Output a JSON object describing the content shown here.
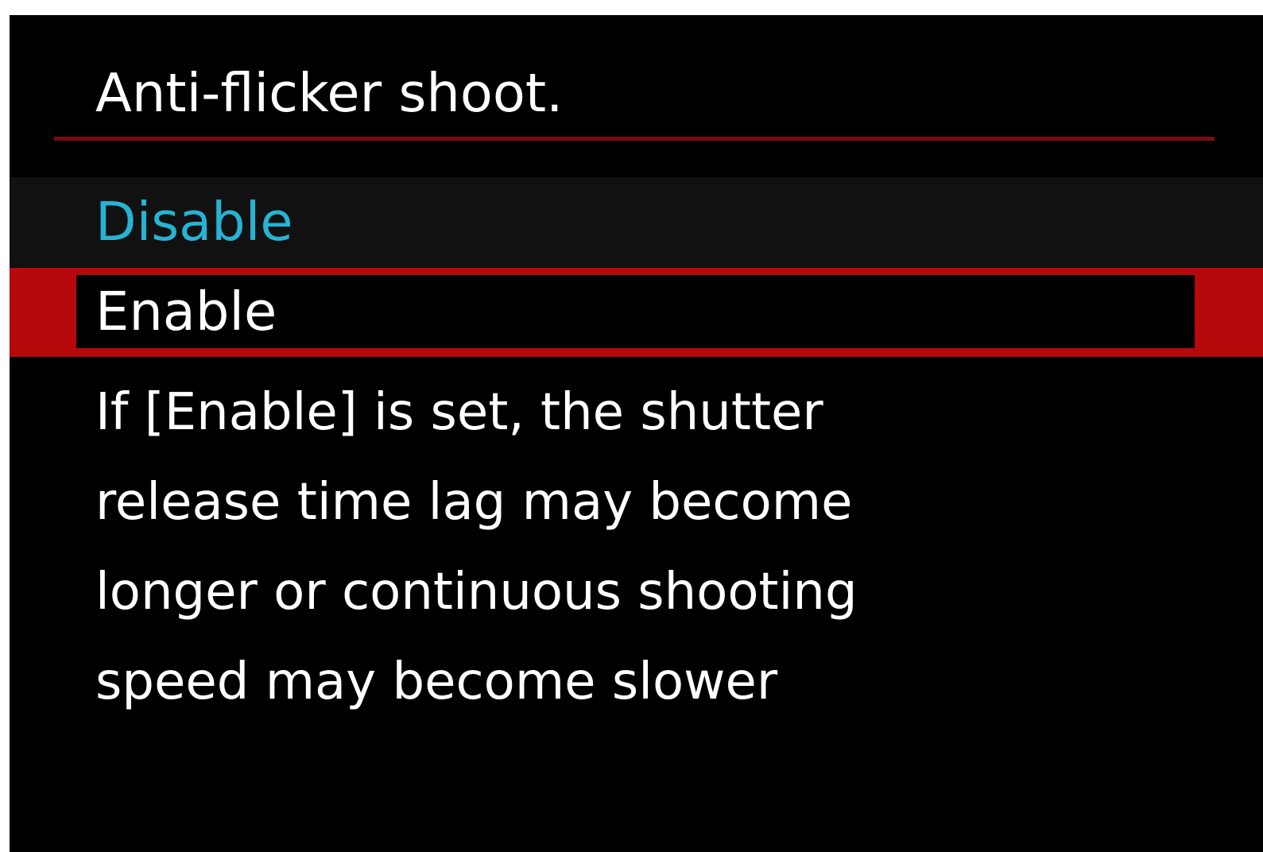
{
  "menu": {
    "title": "Anti-flicker shoot.",
    "options": [
      {
        "label": "Disable",
        "state": "current-setting"
      },
      {
        "label": "Enable",
        "state": "cursor-selected"
      }
    ],
    "description_lines": [
      "If [Enable] is set, the shutter",
      "release time lag may become",
      "longer or continuous shooting",
      "speed may become slower"
    ]
  },
  "colors": {
    "background": "#000000",
    "title_rule": "#7a0c12",
    "current_setting_text": "#27b3d3",
    "selection_frame": "#b5090c",
    "text": "#ffffff"
  }
}
